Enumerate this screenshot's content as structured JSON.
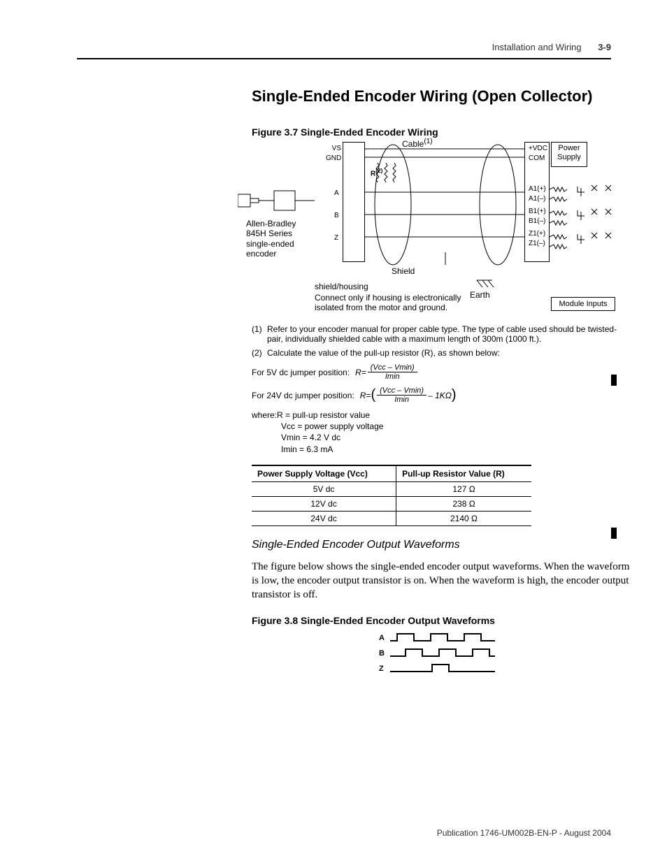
{
  "header": {
    "section": "Installation and Wiring",
    "page": "3-9"
  },
  "title": "Single-Ended Encoder Wiring (Open Collector)",
  "figure37": {
    "caption": "Figure 3.7 Single-Ended Encoder Wiring",
    "labels": {
      "cable": "Cable",
      "cable_sup": "(1)",
      "vs": "VS",
      "gnd": "GND",
      "r": "R",
      "r_sup": "(2)",
      "a": "A",
      "b": "B",
      "z": "Z",
      "vdc": "+VDC",
      "com": "COM",
      "a1p": "A1(+)",
      "a1n": "A1(–)",
      "b1p": "B1(+)",
      "b1n": "B1(–)",
      "z1p": "Z1(+)",
      "z1n": "Z1(–)",
      "power": "Power",
      "supply": "Supply",
      "encoder_l1": "Allen-Bradley",
      "encoder_l2": "845H Series",
      "encoder_l3": "single-ended",
      "encoder_l4": "encoder",
      "shield": "Shield",
      "earth": "Earth",
      "module": "Module Inputs",
      "sh_housing": "shield/housing",
      "sh_note1": "Connect only if housing is electronically",
      "sh_note2": "isolated from the motor and ground."
    }
  },
  "footnotes": {
    "n1_num": "(1)",
    "n1_text": "Refer to your encoder manual for proper cable type. The type of cable used should be twisted-pair, individually shielded cable with a maximum length of 300m (1000 ft.).",
    "n2_num": "(2)",
    "n2_text": "Calculate the value of the pull-up resistor (R), as shown below:"
  },
  "formulas": {
    "lead5": "For 5V dc jumper position:",
    "lead24": "For 24V dc jumper position:",
    "R_eq": "R=",
    "num": "(Vcc – Vmin)",
    "den": "Imin",
    "minus1k": " – 1KΩ",
    "lparen": "(",
    "rparen": ")"
  },
  "where": {
    "l1": "where:R = pull-up resistor value",
    "l2": "Vcc = power supply voltage",
    "l3": "Vmin = 4.2 V dc",
    "l4": "Imin = 6.3 mA"
  },
  "table": {
    "h1": "Power Supply Voltage (Vcc)",
    "h2": "Pull-up Resistor Value (R)",
    "rows": [
      {
        "v": "5V dc",
        "r": "127 Ω"
      },
      {
        "v": "12V dc",
        "r": "238 Ω"
      },
      {
        "v": "24V dc",
        "r": "2140 Ω"
      }
    ]
  },
  "subhead": "Single-Ended Encoder Output Waveforms",
  "body": "The figure below shows the single-ended encoder output waveforms. When the waveform is low, the encoder output transistor is on. When the waveform is high, the encoder output transistor is off.",
  "figure38": {
    "caption": "Figure 3.8 Single-Ended Encoder Output Waveforms",
    "A": "A",
    "B": "B",
    "Z": "Z"
  },
  "publication": "Publication 1746-UM002B-EN-P - August 2004"
}
